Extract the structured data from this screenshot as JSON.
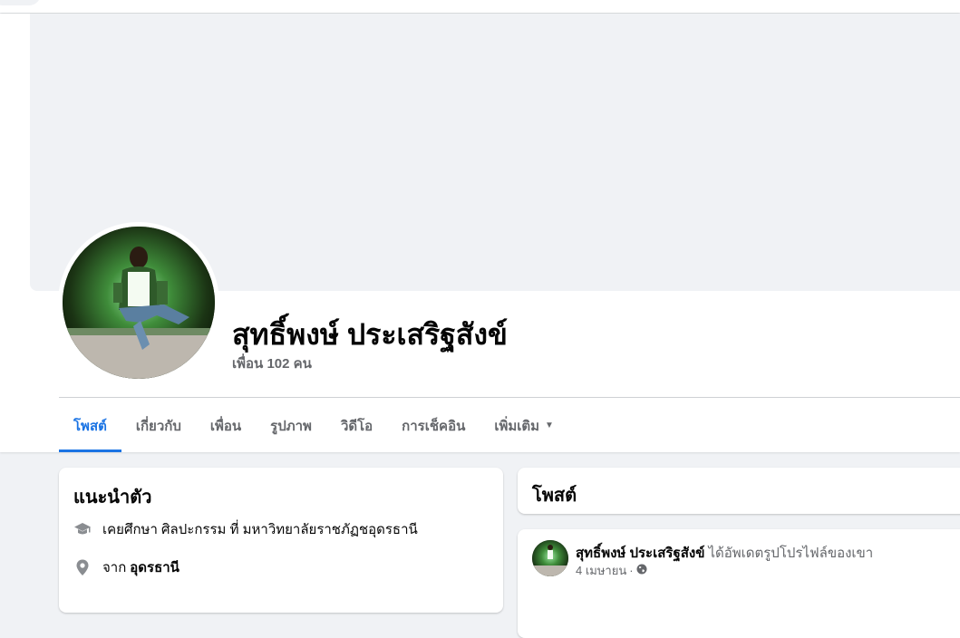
{
  "profile": {
    "name": "สุทธิ์พงษ์ ประเสริฐสังข์",
    "friends": "เพื่อน 102 คน"
  },
  "tabs": [
    {
      "label": "โพสต์",
      "active": true
    },
    {
      "label": "เกี่ยวกับ",
      "active": false
    },
    {
      "label": "เพื่อน",
      "active": false
    },
    {
      "label": "รูปภาพ",
      "active": false
    },
    {
      "label": "วิดีโอ",
      "active": false
    },
    {
      "label": "การเช็คอิน",
      "active": false
    },
    {
      "label": "เพิ่มเติม",
      "active": false,
      "icon": "caret-down-icon"
    }
  ],
  "intro": {
    "title": "แนะนำตัว",
    "education": {
      "icon": "graduation-cap-icon",
      "text": "เคยศึกษา ศิลปะกรรม ที่ มหาวิทยาลัยราชภัฏชอุดรธานี"
    },
    "hometown": {
      "icon": "location-pin-icon",
      "prefix": "จาก",
      "place": "อุดรธานี"
    }
  },
  "posts": {
    "header": "โพสต์",
    "items": [
      {
        "author": "สุทธิ์พงษ์ ประเสริฐสังข์",
        "action": "ได้อัพเดตรูปโปรไฟล์ของเขา",
        "date": "4 เมษายน",
        "separator": "·",
        "privacy_icon": "globe-icon"
      }
    ]
  },
  "colors": {
    "accent": "#1b74e4",
    "secondary_text": "#65676b",
    "background": "#f0f2f5"
  }
}
